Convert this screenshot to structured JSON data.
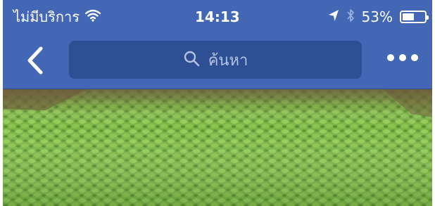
{
  "status_bar": {
    "carrier": "ไม่มีบริการ",
    "time": "14:13",
    "battery_percent": "53%",
    "battery_level": 0.53,
    "icons": [
      "wifi-icon",
      "location-arrow-icon",
      "bluetooth-icon",
      "battery-icon"
    ]
  },
  "nav": {
    "back_icon": "chevron-left-icon",
    "search": {
      "placeholder": "ค้นหา",
      "icon": "search-icon"
    },
    "more_icon": "more-dots-icon"
  },
  "cover": {
    "description_icon": "cover-photo"
  },
  "colors": {
    "header": "#4367b4",
    "search_field": "#2e4f94",
    "search_text": "#b4c3e3",
    "foreground": "#ffffff"
  }
}
